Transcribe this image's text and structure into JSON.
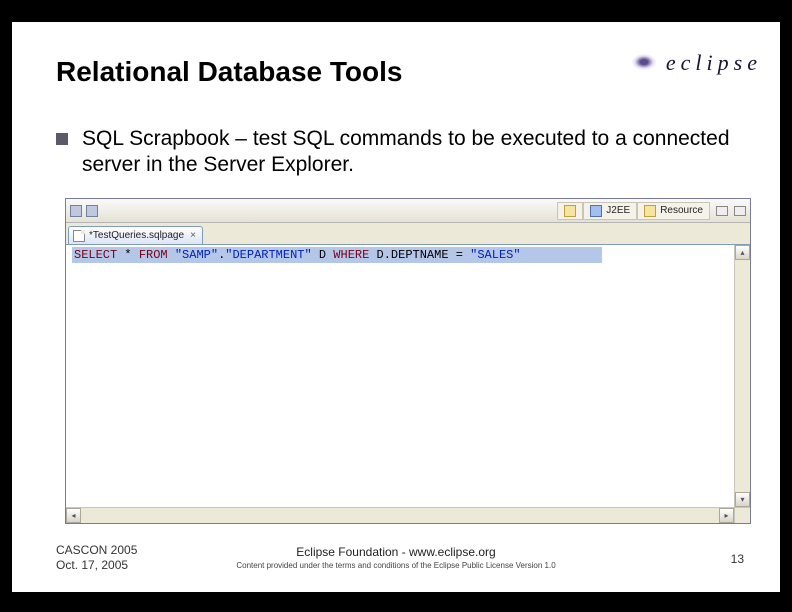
{
  "slide": {
    "title": "Relational Database Tools",
    "bullet": "SQL Scrapbook – test SQL commands to be executed to a connected server in the Server Explorer.",
    "logo_text": "eclipse"
  },
  "ide": {
    "perspectives": {
      "j2ee": "J2EE",
      "resource": "Resource"
    },
    "tab": {
      "filename": "*TestQueries.sqlpage",
      "close": "×"
    },
    "sql": {
      "kw_select": "SELECT",
      "star": " * ",
      "kw_from": "FROM",
      "sp1": " ",
      "lit_schema": "\"SAMP\"",
      "dot1": ".",
      "lit_table": "\"DEPARTMENT\"",
      "sp2": " ",
      "alias": "D",
      "sp3": " ",
      "kw_where": "WHERE",
      "sp4": " ",
      "col": "D.DEPTNAME",
      "sp5": " ",
      "eq": "=",
      "sp6": " ",
      "lit_val": "\"SALES\""
    },
    "scroll": {
      "up": "▴",
      "down": "▾",
      "left": "◂",
      "right": "▸"
    }
  },
  "footer": {
    "event_line1": "CASCON 2005",
    "event_line2": "Oct. 17, 2005",
    "center": "Eclipse Foundation - www.eclipse.org",
    "license": "Content provided under the terms and conditions of the Eclipse Public License Version 1.0",
    "page": "13"
  }
}
